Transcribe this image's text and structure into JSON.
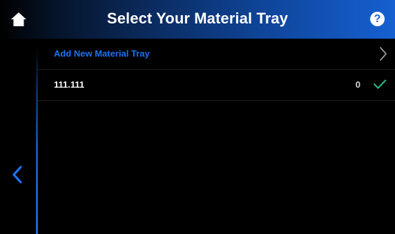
{
  "header": {
    "title": "Select Your Material Tray",
    "help_label": "?",
    "home_icon": "home-icon",
    "help_icon": "help-icon"
  },
  "sidebar": {
    "back_icon": "chevron-left-icon"
  },
  "list": {
    "add_label": "Add New Material Tray",
    "items": [
      {
        "name": "111.111",
        "count": "0",
        "selected": true
      }
    ]
  },
  "colors": {
    "accent": "#1d72f0",
    "check": "#2ab87a",
    "header_gradient_end": "#1660d2"
  }
}
